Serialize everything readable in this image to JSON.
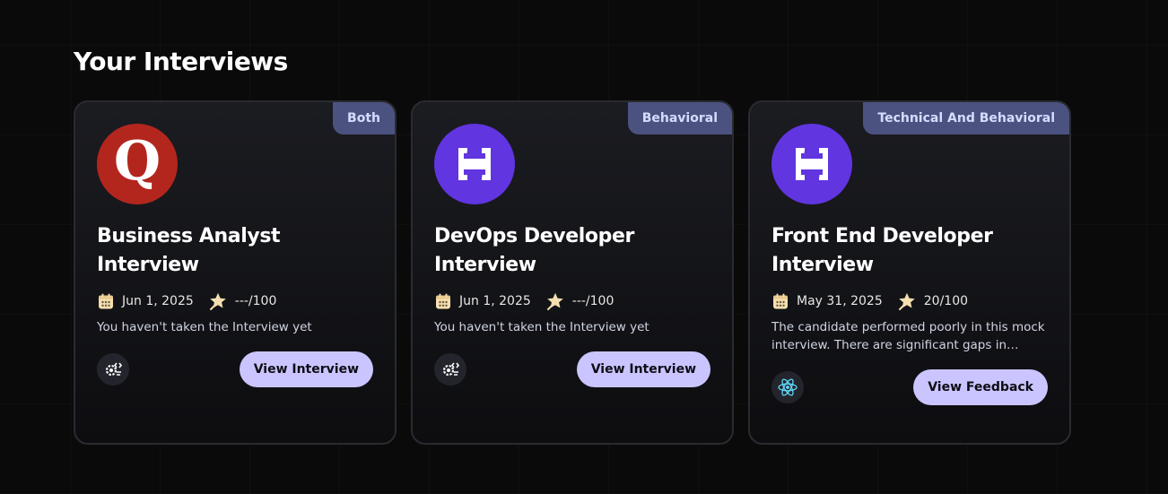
{
  "section": {
    "title": "Your Interviews"
  },
  "colors": {
    "accent_button": "#cac5fe",
    "badge_bg": "#4c5280",
    "quora_red": "#b3261e",
    "hackerrank_purple": "#6135e0"
  },
  "cards": [
    {
      "badge": "Both",
      "logo": "quora-logo",
      "logo_letter": "Q",
      "title": "Business Analyst Interview",
      "date": "Jun 1, 2025",
      "score": "---/100",
      "description": "You haven't taken the Interview yet",
      "tech_icon": "gear-code-icon",
      "button_label": "View Interview"
    },
    {
      "badge": "Behavioral",
      "logo": "hackerrank-logo",
      "title": "DevOps Developer Interview",
      "date": "Jun 1, 2025",
      "score": "---/100",
      "description": "You haven't taken the Interview yet",
      "tech_icon": "gear-code-icon",
      "button_label": "View Interview"
    },
    {
      "badge": "Technical And Behavioral",
      "logo": "hackerrank-logo",
      "title": "Front End Developer Interview",
      "date": "May 31, 2025",
      "score": "20/100",
      "description": "The candidate performed poorly in this mock interview. There are significant gaps in technical understanding and communication.",
      "tech_icon": "react-icon",
      "button_label": "View Feedback"
    }
  ]
}
